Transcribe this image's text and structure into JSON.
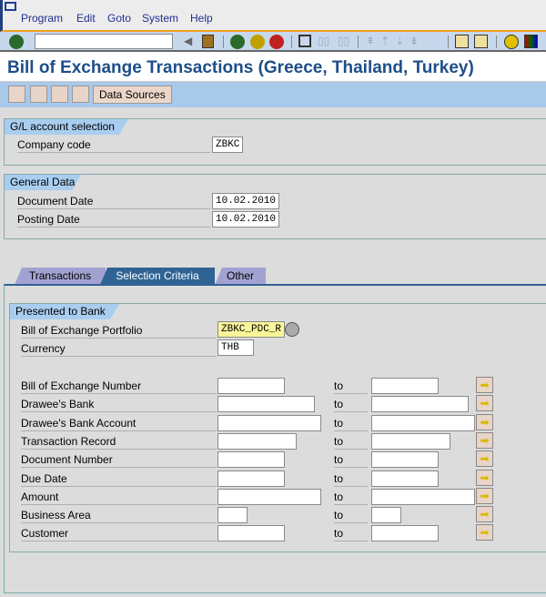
{
  "menu": [
    "Program",
    "Edit",
    "Goto",
    "System",
    "Help"
  ],
  "title": "Bill of Exchange Transactions (Greece, Thailand, Turkey)",
  "app_toolbar": {
    "data_sources": "Data Sources"
  },
  "gl_group": {
    "title": "G/L account selection",
    "company_code_label": "Company code",
    "company_code": "ZBKC"
  },
  "general_group": {
    "title": "General Data",
    "document_date_label": "Document Date",
    "document_date": "10.02.2010",
    "posting_date_label": "Posting Date",
    "posting_date": "10.02.2010"
  },
  "tabs": [
    "Transactions",
    "Selection Criteria",
    "Other"
  ],
  "bank_group": {
    "title": "Presented to Bank",
    "portfolio_label": "Bill of Exchange Portfolio",
    "portfolio": "ZBKC_PDC_R",
    "currency_label": "Currency",
    "currency": "THB",
    "to_label": "to",
    "ranges": [
      "Bill of Exchange Number",
      "Drawee's Bank",
      "Drawee's Bank Account",
      "Transaction Record",
      "Document Number",
      "Due Date",
      "Amount",
      "Business Area",
      "Customer"
    ]
  }
}
